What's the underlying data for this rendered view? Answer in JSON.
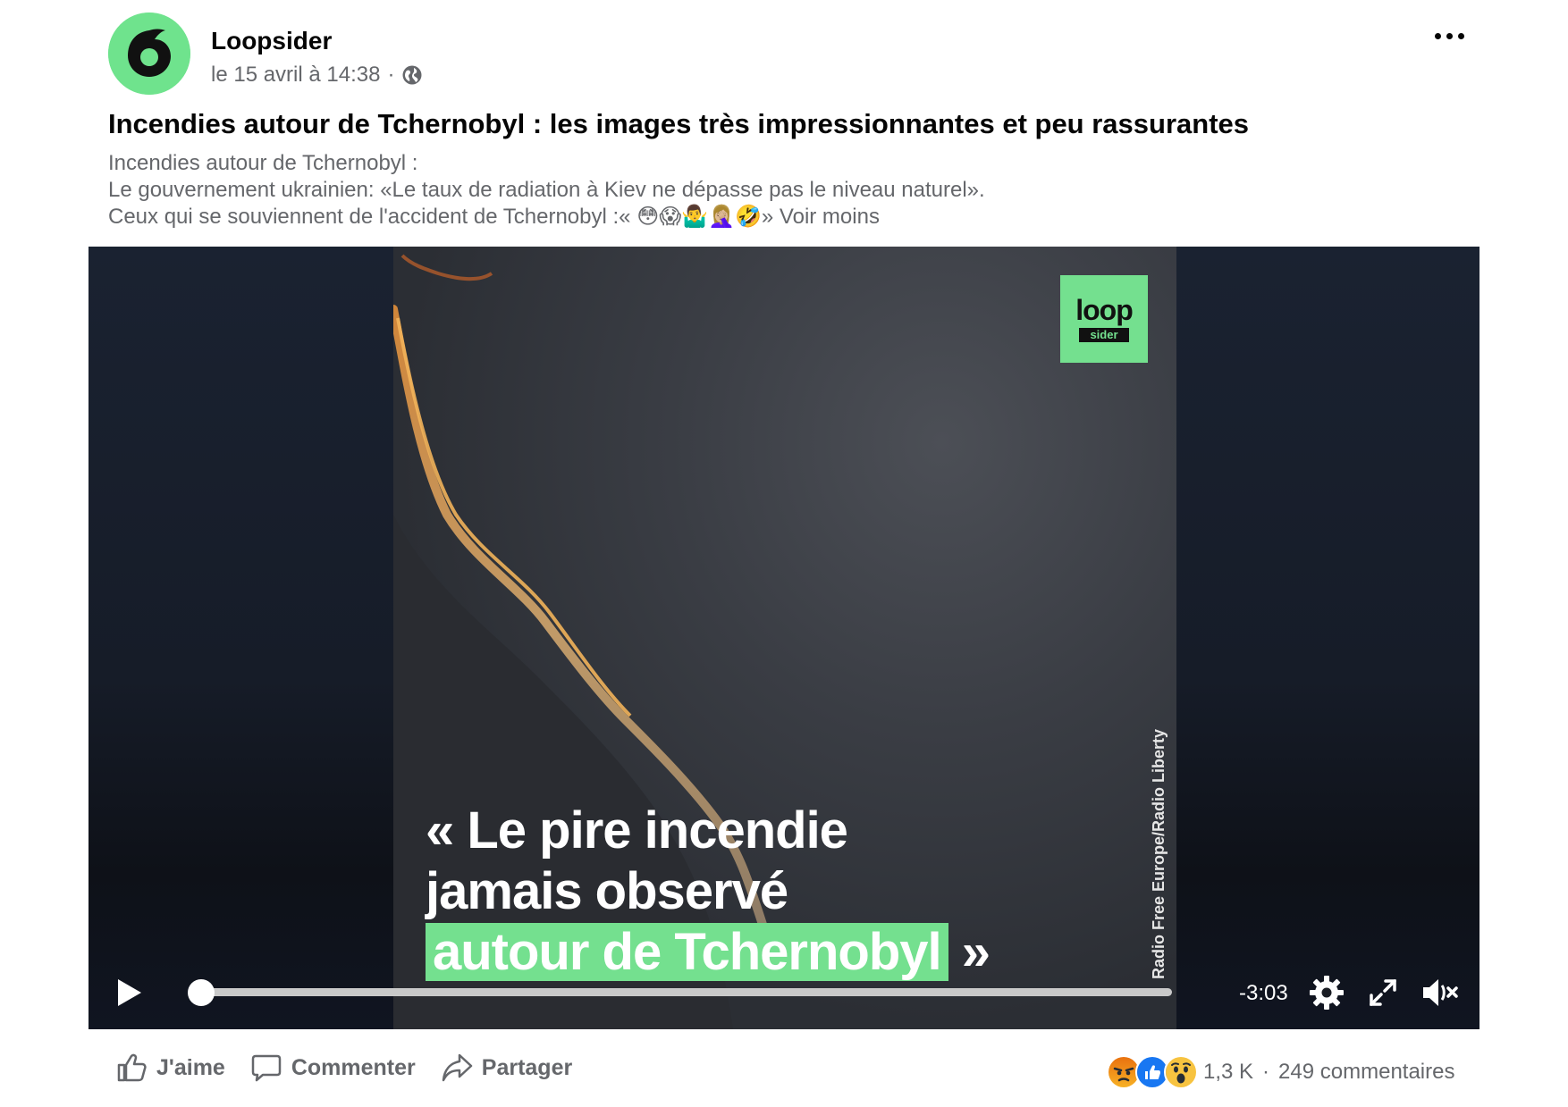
{
  "post": {
    "page_name": "Loopsider",
    "date": "le 15 avril à 14:38",
    "separator": "·",
    "title": "Incendies autour de Tchernobyl : les images très impressionnantes et peu rassurantes",
    "description_lines": [
      "Incendies autour de Tchernobyl :",
      "Le gouvernement ukrainien: «Le taux de radiation à Kiev ne dépasse pas le niveau naturel».",
      "Ceux qui se souviennent de l'accident de Tchernobyl :« 😳😱🤷‍♂️🤦🏼‍♀️🤣»"
    ],
    "see_less": "Voir moins"
  },
  "video": {
    "logo_top": "loop",
    "logo_bottom": "sider",
    "credit": "Radio Free Europe/Radio Liberty",
    "caption_line1": "« Le pire incendie",
    "caption_line2": "jamais observé",
    "caption_line3_highlight": "autour de Tchernobyl",
    "caption_line3_end": " »",
    "time_remaining": "-3:03",
    "progress": 0.0
  },
  "actions": {
    "like": "J'aime",
    "comment": "Commenter",
    "share": "Partager"
  },
  "stats": {
    "reactions_count": "1,3 K",
    "separator": "·",
    "comments": "249 commentaires",
    "reaction_icons": [
      "angry-icon",
      "like-icon",
      "wow-icon"
    ]
  },
  "colors": {
    "brand_green": "#74e08f",
    "meta_gray": "#65676b",
    "like_blue": "#1877f2"
  }
}
